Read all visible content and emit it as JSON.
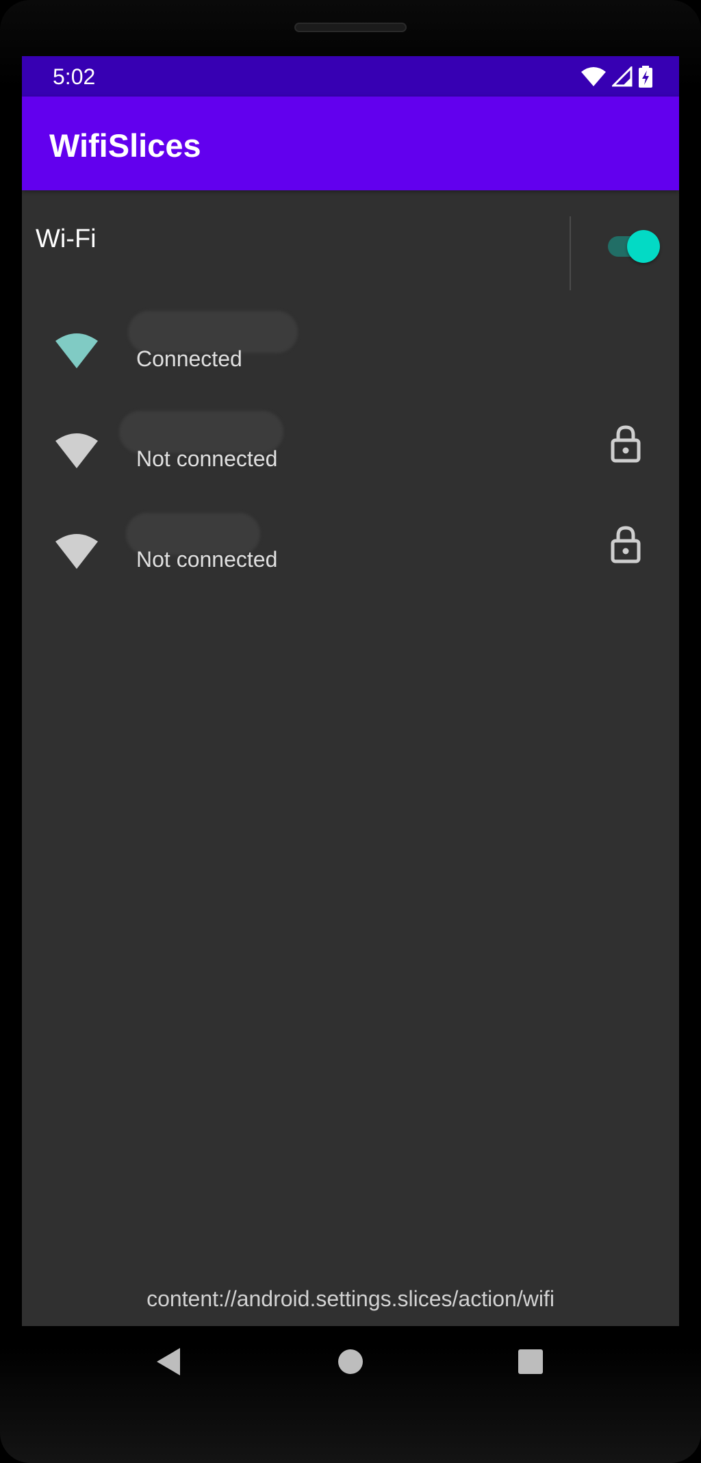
{
  "status_bar": {
    "time": "5:02",
    "icons": [
      "wifi-icon",
      "signal-icon",
      "battery-charging-icon"
    ]
  },
  "app_bar": {
    "title": "WifiSlices"
  },
  "wifi": {
    "label": "Wi-Fi",
    "enabled": true
  },
  "networks": [
    {
      "name": "",
      "status": "Connected",
      "secured": false,
      "icon": "wifi-signal-icon",
      "color": "#80cbc4"
    },
    {
      "name": "",
      "status": "Not connected",
      "secured": true,
      "icon": "wifi-signal-icon",
      "color": "#cfcfcf"
    },
    {
      "name": "",
      "status": "Not connected",
      "secured": true,
      "icon": "wifi-signal-icon",
      "color": "#cfcfcf"
    }
  ],
  "slice_uri": "content://android.settings.slices/action/wifi",
  "nav": {
    "icons": [
      "back-icon",
      "home-icon",
      "recents-icon"
    ]
  },
  "colors": {
    "status_bar": "#3700b3",
    "app_bar": "#6200ee",
    "background": "#303030",
    "accent": "#03dac5"
  }
}
